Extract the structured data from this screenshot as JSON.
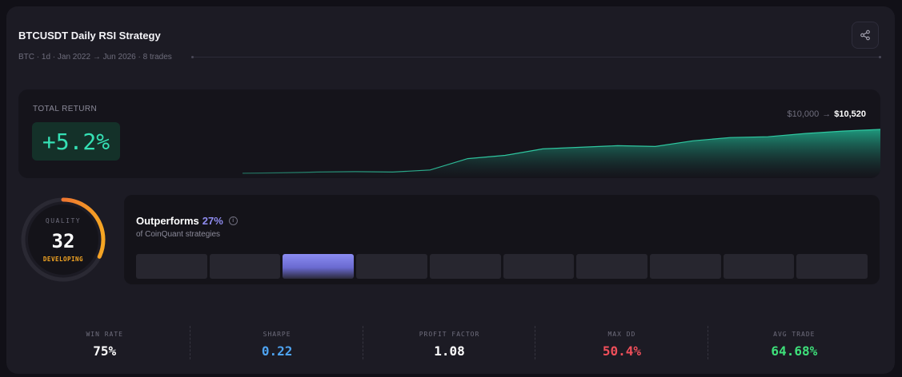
{
  "strategy": {
    "title": "BTCUSDT Daily RSI Strategy",
    "subtitle": "BTC · 1d · Jan 2022 → Jun 2026 · 8 trades"
  },
  "total_return": {
    "label": "TOTAL RETURN",
    "value": "+5.2%",
    "start_balance": "$10,000",
    "arrow": "→",
    "end_balance": "$10,520",
    "color": "#35e0b4"
  },
  "equity_curve": [
    9980,
    9985,
    9995,
    10000,
    9995,
    10020,
    10160,
    10200,
    10280,
    10300,
    10320,
    10310,
    10380,
    10420,
    10430,
    10470,
    10500,
    10520
  ],
  "quality": {
    "label": "QUALITY",
    "score": "32",
    "status": "DEVELOPING",
    "fraction": 0.32,
    "status_color": "#f5a623"
  },
  "outperforms": {
    "label": "Outperforms",
    "percent": "27%",
    "info_icon": "info-icon",
    "subtitle": "of CoinQuant strategies",
    "bucket_count": 10,
    "active_bucket": 2
  },
  "stats": [
    {
      "label": "WIN RATE",
      "value": "75%",
      "color": "#ffffff"
    },
    {
      "label": "SHARPE",
      "value": "0.22",
      "color": "#4ea3f0"
    },
    {
      "label": "PROFIT FACTOR",
      "value": "1.08",
      "color": "#ffffff"
    },
    {
      "label": "MAX DD",
      "value": "50.4%",
      "color": "#ef4f5a"
    },
    {
      "label": "AVG TRADE",
      "value": "64.68%",
      "color": "#3ee07a"
    }
  ],
  "icons": {
    "share": "share-icon"
  }
}
